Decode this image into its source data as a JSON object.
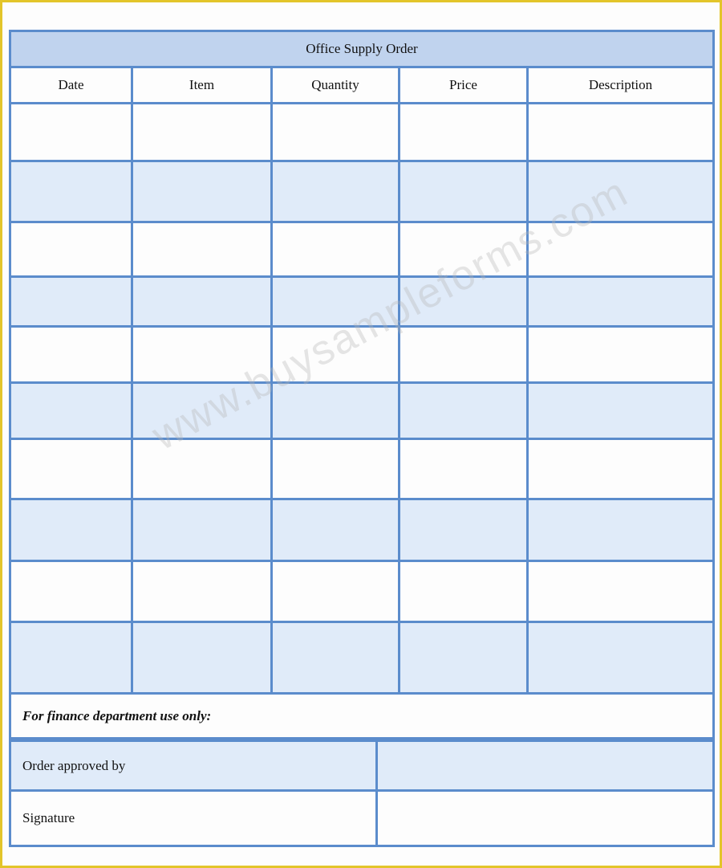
{
  "form": {
    "title": "Office Supply Order",
    "columns": [
      "Date",
      "Item",
      "Quantity",
      "Price",
      "Description"
    ],
    "row_count": 10,
    "finance_note": "For finance department use only:",
    "approved_label": "Order approved by",
    "signature_label": "Signature"
  },
  "watermark": "www.buysampleforms.com",
  "colors": {
    "border": "#5b8ccc",
    "title_bg": "#c0d3ee",
    "alt_row": "#e0ebf9",
    "frame": "#e3c52a"
  }
}
